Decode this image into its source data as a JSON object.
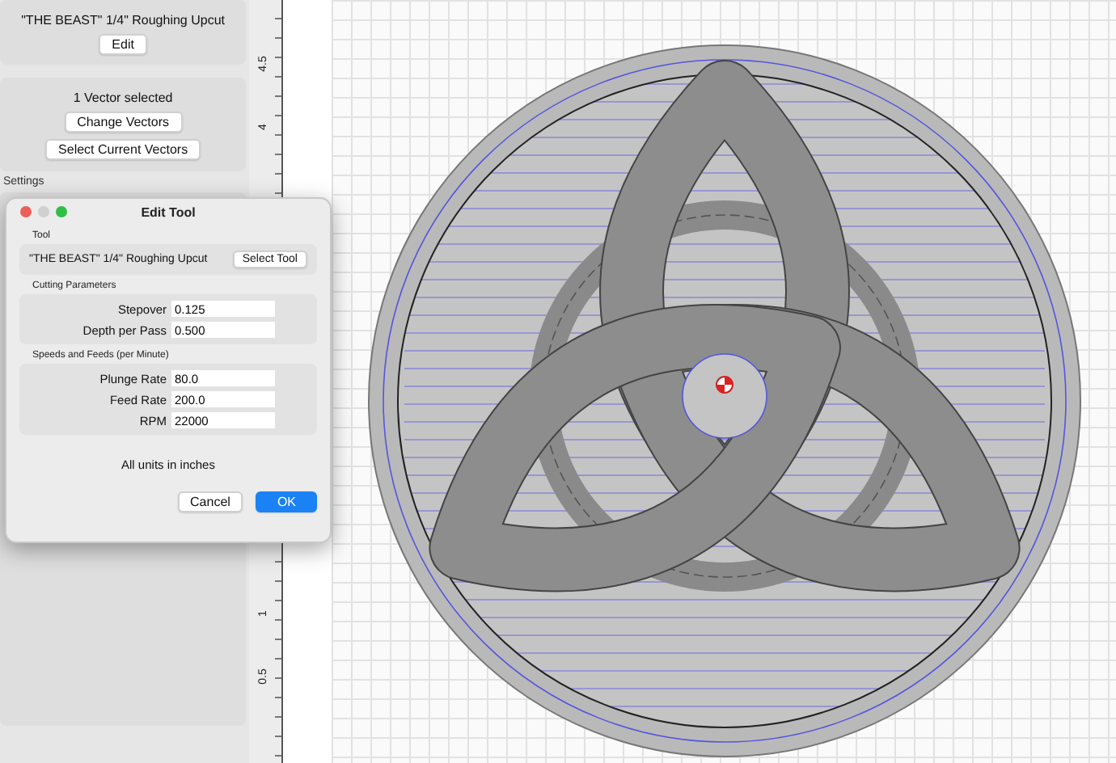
{
  "sidebar": {
    "tool_card": {
      "tool_name": "\"THE BEAST\" 1/4\" Roughing Upcut",
      "button": "Edit"
    },
    "vector_card": {
      "status": "1 Vector selected",
      "buttons": [
        "Change Vectors",
        "Select Current Vectors"
      ]
    },
    "section_label": "Settings"
  },
  "ruler": {
    "labels": [
      {
        "text": "4.5",
        "kind": "top"
      },
      {
        "text": "4",
        "kind": "top"
      },
      {
        "text": "1",
        "kind": "bottom"
      },
      {
        "text": "0.5",
        "kind": "bottom"
      }
    ]
  },
  "dialog": {
    "title": "Edit Tool",
    "sections": [
      {
        "kind": "tool",
        "title": "Tool",
        "tool_name": "\"THE BEAST\" 1/4\" Roughing Upcut",
        "button": "Select Tool"
      },
      {
        "kind": "fields",
        "title": "Cutting Parameters",
        "fields": [
          {
            "label": "Stepover",
            "value": "0.125"
          },
          {
            "label": "Depth per Pass",
            "value": "0.500"
          }
        ]
      },
      {
        "kind": "fields",
        "title": "Speeds and Feeds (per Minute)",
        "fields": [
          {
            "label": "Plunge Rate",
            "value": "80.0"
          },
          {
            "label": "Feed Rate",
            "value": "200.0"
          },
          {
            "label": "RPM",
            "value": "22000"
          }
        ]
      }
    ],
    "note": "All units in inches",
    "buttons": [
      {
        "label": "Cancel",
        "primary": false
      },
      {
        "label": "OK",
        "primary": true
      }
    ]
  }
}
